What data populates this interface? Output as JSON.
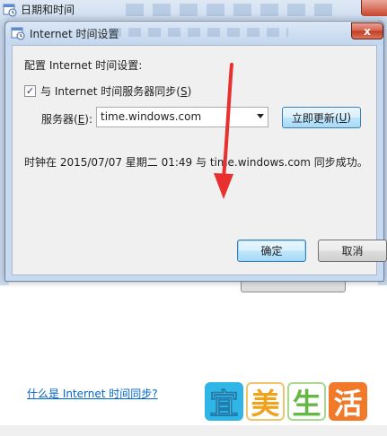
{
  "parent_window": {
    "title": "日期和时间",
    "help_link": "什么是 Internet 时间同步?"
  },
  "dialog": {
    "title": "Internet 时间设置",
    "close_glyph": "x",
    "heading": "配置 Internet 时间设置:",
    "sync_checkbox": {
      "checked": true,
      "check_glyph": "✓",
      "label": "与 Internet 时间服务器同步(",
      "hotkey": "S",
      "label_end": ")"
    },
    "server_label": "服务器(",
    "server_hotkey": "E",
    "server_label_end": "):",
    "server_value": "time.windows.com",
    "update_button": {
      "label": "立即更新(",
      "hotkey": "U",
      "label_end": ")"
    },
    "status_text": "时钟在 2015/07/07 星期二 01:49 与 time.windows.com 同步成功。",
    "ok_label": "确定",
    "cancel_label": "取消"
  },
  "watermark": {
    "chars": [
      "宜",
      "美",
      "生",
      "活"
    ]
  },
  "colors": {
    "arrow": "#e8302f",
    "link": "#0066cc",
    "frame": "#c8daf0"
  },
  "icons": [
    "calendar-clock-icon",
    "close-icon",
    "dropdown-arrow-icon",
    "check-icon"
  ]
}
